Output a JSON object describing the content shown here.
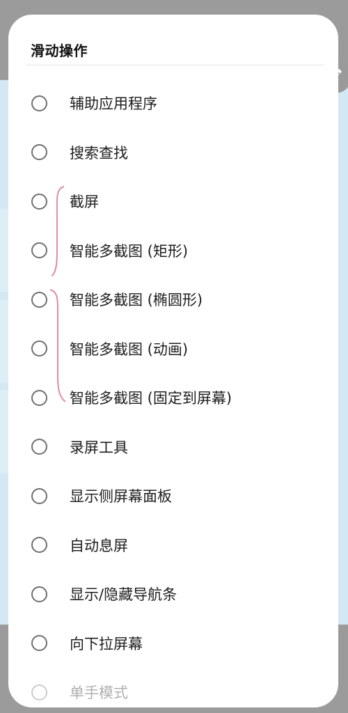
{
  "dialog": {
    "title": "滑动操作",
    "options": [
      {
        "label": "辅助应用程序"
      },
      {
        "label": "搜索查找"
      },
      {
        "label": "截屏"
      },
      {
        "label": "智能多截图 (矩形)"
      },
      {
        "label": "智能多截图 (椭圆形)"
      },
      {
        "label": "智能多截图 (动画)"
      },
      {
        "label": "智能多截图 (固定到屏幕)"
      },
      {
        "label": "录屏工具"
      },
      {
        "label": "显示侧屏幕面板"
      },
      {
        "label": "自动息屏"
      },
      {
        "label": "显示/隐藏导航条"
      },
      {
        "label": "向下拉屏幕"
      },
      {
        "label": "单手模式"
      }
    ]
  },
  "colors": {
    "bracket": "#e08aaa",
    "dialog_bg": "#ffffff",
    "fab_bg": "#9a9a9a"
  },
  "icons": {
    "edit_fab": "pencil-icon"
  }
}
